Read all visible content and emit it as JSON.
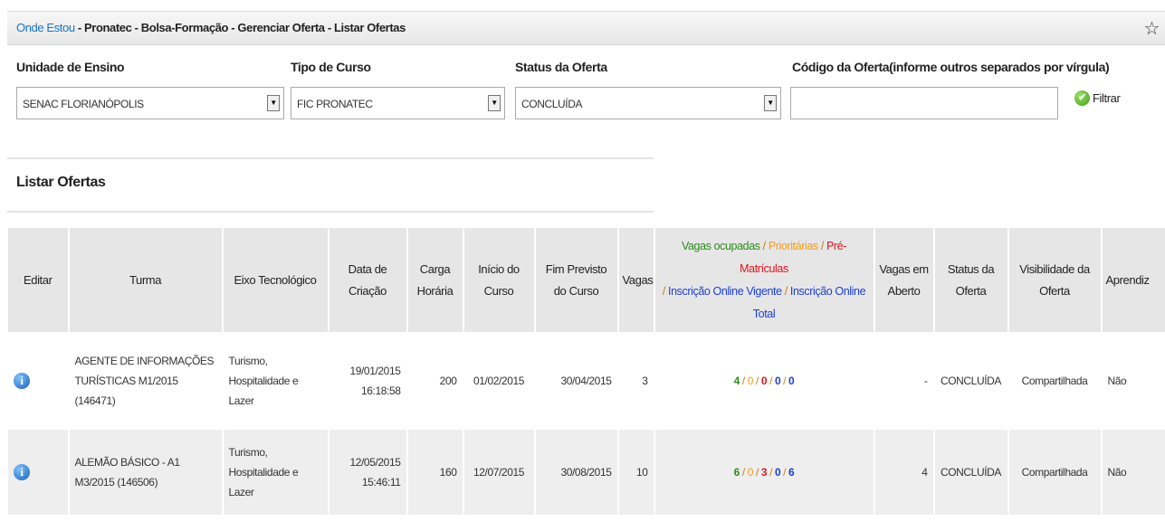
{
  "breadcrumb": {
    "link": "Onde Estou",
    "path": " - Pronatec - Bolsa-Formação - Gerenciar Oferta - Listar Ofertas"
  },
  "filters": {
    "unidade_label": "Unidade de Ensino",
    "unidade_value": "SENAC FLORIANÓPOLIS",
    "tipo_label": "Tipo de Curso",
    "tipo_value": "FIC PRONATEC",
    "status_label": "Status da Oferta",
    "status_value": "CONCLUÍDA",
    "codigo_label": "Código da Oferta(informe outros separados por vírgula)",
    "codigo_value": "",
    "filtrar_label": "Filtrar"
  },
  "section_title": "Listar Ofertas",
  "table": {
    "headers": {
      "editar": "Editar",
      "turma": "Turma",
      "eixo": "Eixo Tecnológico",
      "data_criacao": "Data de Criação",
      "carga": "Carga Horária",
      "inicio": "Início do Curso",
      "fim": "Fim Previsto do Curso",
      "vagas": "Vagas",
      "vagas_ocupadas": "Vagas ocupadas",
      "prioritarias": "Prioritárias",
      "pre_matriculas": "Pré-Matrículas",
      "insc_vigente": "Inscrição Online Vigente",
      "insc_total": "Inscrição Online Total",
      "vagas_aberto": "Vagas em Aberto",
      "status": "Status da Oferta",
      "visibilidade": "Visibilidade da Oferta",
      "aprendiz": "Aprendiz"
    },
    "rows": [
      {
        "turma": "AGENTE DE INFORMAÇÕES TURÍSTICAS M1/2015 (146471)",
        "eixo": "Turismo, Hospitalidade e Lazer",
        "data": "19/01/2015",
        "hora": "16:18:58",
        "carga": "200",
        "inicio": "01/02/2015",
        "fim": "30/04/2015",
        "vagas": "3",
        "ocupadas": "4",
        "prioritarias": "0",
        "pre": "0",
        "vigente": "0",
        "total": "0",
        "aberto": "-",
        "status": "CONCLUÍDA",
        "visibilidade": "Compartilhada",
        "aprendiz": "Não"
      },
      {
        "turma": "ALEMÃO BÁSICO - A1 M3/2015 (146506)",
        "eixo": "Turismo, Hospitalidade e Lazer",
        "data": "12/05/2015",
        "hora": "15:46:11",
        "carga": "160",
        "inicio": "12/07/2015",
        "fim": "30/08/2015",
        "vagas": "10",
        "ocupadas": "6",
        "prioritarias": "0",
        "pre": "3",
        "vigente": "0",
        "total": "6",
        "aberto": "4",
        "status": "CONCLUÍDA",
        "visibilidade": "Compartilhada",
        "aprendiz": "Não"
      }
    ]
  },
  "colors": {
    "link": "#1a73c8",
    "green": "#2e8b1e",
    "orange": "#f29d1b",
    "red": "#e0141e",
    "blue": "#1c3fd1"
  },
  "icons": [
    "star-icon",
    "check-icon",
    "info-icon",
    "chevron-down-icon"
  ]
}
